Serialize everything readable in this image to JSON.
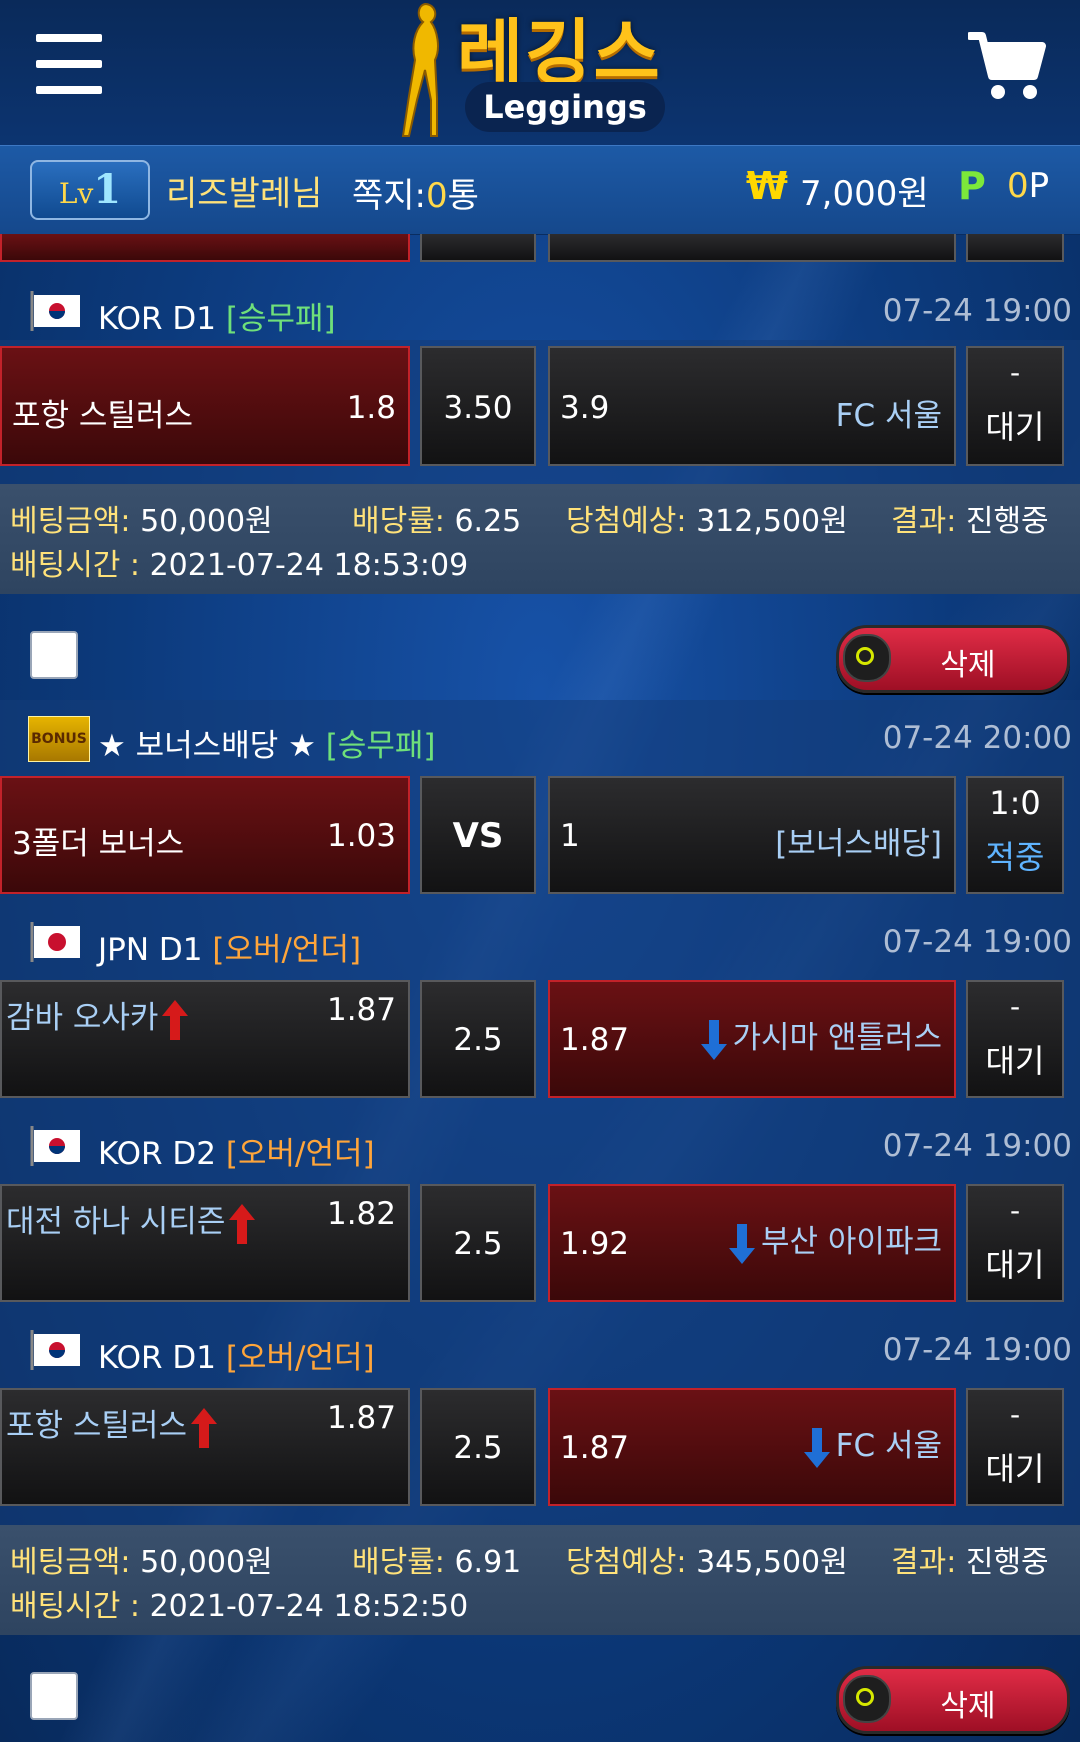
{
  "header": {
    "logo_kr": "레깅스",
    "logo_en": "Leggings",
    "menu_icon": "hamburger-icon",
    "cart_icon": "cart-icon"
  },
  "userbar": {
    "level_prefix": "Lv",
    "level": "1",
    "username": "리즈발레님",
    "msg_label": "쪽지:",
    "msg_count": "0",
    "msg_unit": "통",
    "money_icon": "₩",
    "money": "7,000원",
    "points_icon": "P",
    "points_value": "0",
    "points_unit": "P"
  },
  "bet1": {
    "game": {
      "league": "KOR D1",
      "type": "[승무패]",
      "time": "07-24 19:00",
      "home": "포항 스틸러스",
      "home_odds": "1.8",
      "mid": "3.50",
      "away_odds": "3.9",
      "away": "FC 서울",
      "status_top": "-",
      "status": "대기"
    },
    "summary": {
      "amount_label": "베팅금액:",
      "amount": "50,000원",
      "odds_label": "배당률:",
      "odds": "6.25",
      "win_label": "당첨예상:",
      "win": "312,500원",
      "result_label": "결과:",
      "result": "진행중",
      "time_label": "배팅시간 :",
      "time": "2021-07-24 18:53:09"
    },
    "delete_label": "삭제"
  },
  "bet2": {
    "games": [
      {
        "league": "★ 보너스배당 ★",
        "type": "[승무패]",
        "time": "07-24 20:00",
        "home": "3폴더 보너스",
        "home_odds": "1.03",
        "mid": "VS",
        "away_odds": "1",
        "away": "[보너스배당]",
        "status_top": "1:0",
        "status": "적중"
      },
      {
        "league": "JPN D1",
        "type": "[오버/언더]",
        "time": "07-24 19:00",
        "home": "감바 오사카",
        "home_odds": "1.87",
        "mid": "2.5",
        "away_odds": "1.87",
        "away": "가시마 앤틀러스",
        "status_top": "-",
        "status": "대기"
      },
      {
        "league": "KOR D2",
        "type": "[오버/언더]",
        "time": "07-24 19:00",
        "home": "대전 하나 시티즌",
        "home_odds": "1.82",
        "mid": "2.5",
        "away_odds": "1.92",
        "away": "부산 아이파크",
        "status_top": "-",
        "status": "대기"
      },
      {
        "league": "KOR D1",
        "type": "[오버/언더]",
        "time": "07-24 19:00",
        "home": "포항 스틸러스",
        "home_odds": "1.87",
        "mid": "2.5",
        "away_odds": "1.87",
        "away": "FC 서울",
        "status_top": "-",
        "status": "대기"
      }
    ],
    "summary": {
      "amount_label": "베팅금액:",
      "amount": "50,000원",
      "odds_label": "배당률:",
      "odds": "6.91",
      "win_label": "당첨예상:",
      "win": "345,500원",
      "result_label": "결과:",
      "result": "진행중",
      "time_label": "배팅시간 :",
      "time": "2021-07-24 18:52:50"
    },
    "delete_label": "삭제"
  },
  "bonus_badge": "BONUS",
  "colors": {
    "accent_red": "#c2222a",
    "accent_yellow": "#ffe27a",
    "green_type": "#6fe07a",
    "orange_type": "#ffa53a",
    "hit_blue": "#5fb4ff"
  }
}
